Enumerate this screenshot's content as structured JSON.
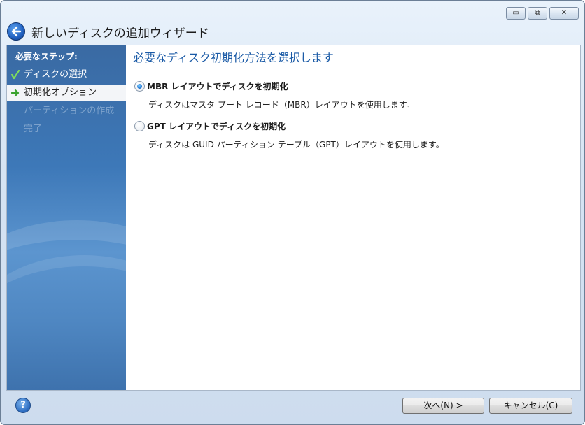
{
  "window": {
    "title": "新しいディスクの追加ウィザード",
    "minimize_glyph": "▭",
    "restore_glyph": "⧉",
    "close_glyph": "✕"
  },
  "sidebar": {
    "header": "必要なステップ:",
    "steps": [
      {
        "label": "ディスクの選択",
        "state": "done"
      },
      {
        "label": "初期化オプション",
        "state": "current"
      },
      {
        "label": "パーティションの作成",
        "state": "pending"
      },
      {
        "label": "完了",
        "state": "pending"
      }
    ]
  },
  "main": {
    "heading": "必要なディスク初期化方法を選択します",
    "options": [
      {
        "label": "MBR レイアウトでディスクを初期化",
        "description": "ディスクはマスタ ブート レコード（MBR）レイアウトを使用します。",
        "selected": true
      },
      {
        "label": "GPT レイアウトでディスクを初期化",
        "description": "ディスクは GUID パーティション テーブル（GPT）レイアウトを使用します。",
        "selected": false
      }
    ]
  },
  "footer": {
    "help_glyph": "?",
    "next_label": "次へ(N) >",
    "cancel_label": "キャンセル(C)"
  },
  "colors": {
    "heading": "#1a5aa6",
    "sidebar": "#3d78b8",
    "pending_step": "#7da2cc"
  }
}
